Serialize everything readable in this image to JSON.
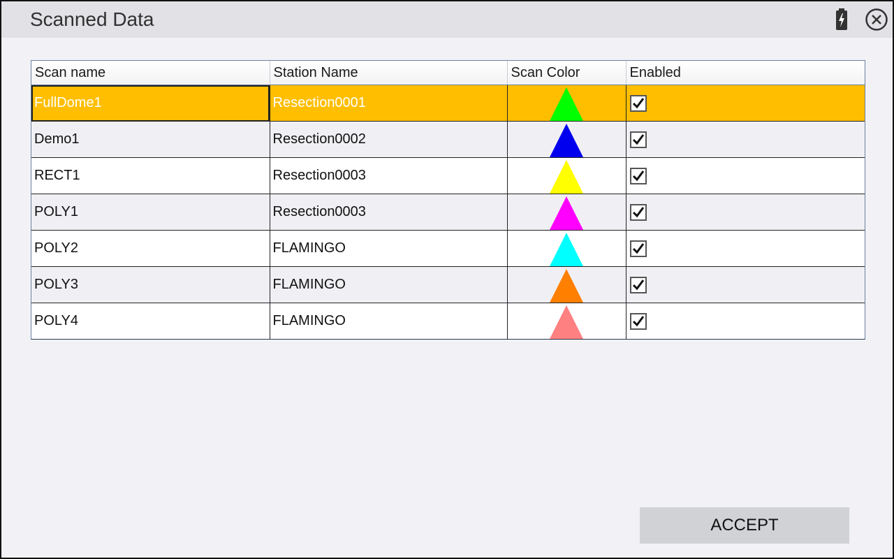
{
  "window": {
    "title": "Scanned Data",
    "icons": {
      "battery": "battery-charging-icon",
      "close": "close-circle-icon"
    }
  },
  "table": {
    "columns": [
      "Scan name",
      "Station Name",
      "Scan Color",
      "Enabled"
    ],
    "rows": [
      {
        "scan_name": "FullDome1",
        "station_name": "Resection0001",
        "color": "#00ff00",
        "enabled": true,
        "selected": true
      },
      {
        "scan_name": "Demo1",
        "station_name": "Resection0002",
        "color": "#0000ee",
        "enabled": true,
        "selected": false
      },
      {
        "scan_name": "RECT1",
        "station_name": "Resection0003",
        "color": "#ffff00",
        "enabled": true,
        "selected": false
      },
      {
        "scan_name": "POLY1",
        "station_name": "Resection0003",
        "color": "#ff00ff",
        "enabled": true,
        "selected": false
      },
      {
        "scan_name": "POLY2",
        "station_name": "FLAMINGO",
        "color": "#00ffff",
        "enabled": true,
        "selected": false
      },
      {
        "scan_name": "POLY3",
        "station_name": "FLAMINGO",
        "color": "#ff7f00",
        "enabled": true,
        "selected": false
      },
      {
        "scan_name": "POLY4",
        "station_name": "FLAMINGO",
        "color": "#ff8080",
        "enabled": true,
        "selected": false
      }
    ]
  },
  "accept_button": {
    "label": "ACCEPT"
  },
  "colors": {
    "selection": "#ffbe00",
    "titlebar": "#e1e1e6",
    "background": "#f2f2f6"
  }
}
